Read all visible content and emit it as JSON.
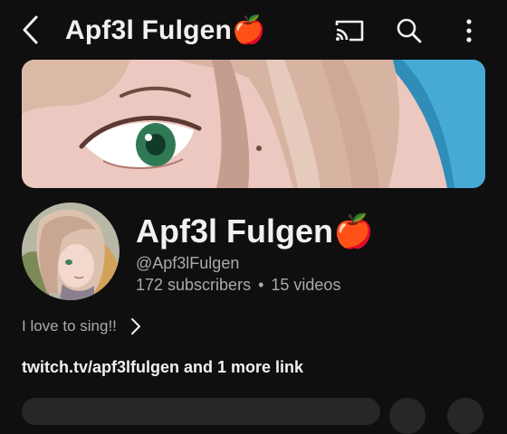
{
  "header": {
    "title": "Apf3l Fulgen🍎",
    "icons": [
      "back-arrow-icon",
      "cast-icon",
      "search-icon",
      "more-vert-icon"
    ]
  },
  "channel": {
    "name": "Apf3l Fulgen🍎",
    "handle": "@Apf3lFulgen",
    "subscribers": "172 subscribers",
    "separator": "•",
    "videos": "15 videos",
    "description": "I love to sing!!",
    "links": "twitch.tv/apf3lfulgen and 1 more link"
  },
  "colors": {
    "background": "#0f0f0f",
    "text_primary": "#f1f1f1",
    "text_secondary": "#aaaaaa",
    "surface": "#272727"
  }
}
